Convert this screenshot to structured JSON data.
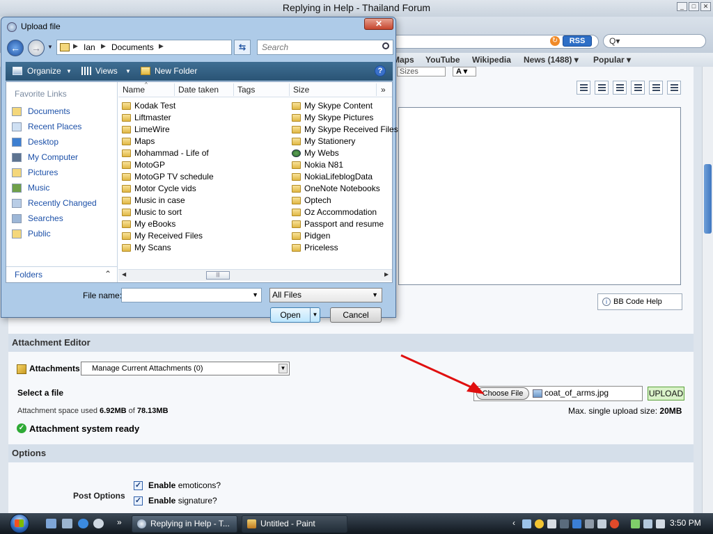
{
  "browser": {
    "window_title": "Replying in Help - Thailand Forum",
    "search_placeholder": "Q▾",
    "rss": "RSS",
    "bookmarks": [
      "Maps",
      "YouTube",
      "Wikipedia",
      "News (1488) ▾",
      "Popular ▾"
    ],
    "window_buttons": [
      "_",
      "□",
      "✕"
    ]
  },
  "editor": {
    "sizes_label": "Sizes",
    "color_label": "A ▾",
    "bbcode_help": "BB Code Help"
  },
  "attachment_editor": {
    "header": "Attachment Editor",
    "attachments_label": "Attachments",
    "attachments_select": "Manage Current Attachments (0)",
    "select_file_label": "Select a file",
    "space_used_prefix": "Attachment space used",
    "space_used": "6.92MB",
    "space_of": "of",
    "space_total": "78.13MB",
    "choose_file": "Choose File",
    "file_name": "coat_of_arms.jpg",
    "upload": "UPLOAD",
    "max_size_label": "Max. single upload size:",
    "max_size": "20MB",
    "ready": "Attachment system ready"
  },
  "options": {
    "header": "Options",
    "post_options_label": "Post Options",
    "checkboxes": [
      {
        "bold": "Enable",
        "rest": " emoticons?"
      },
      {
        "bold": "Enable",
        "rest": " signature?"
      }
    ]
  },
  "dialog": {
    "title": "Upload file",
    "close": "✕",
    "breadcrumb": [
      "Ian",
      "Documents"
    ],
    "search_placeholder": "Search",
    "toolbar": {
      "organize": "Organize",
      "views": "Views",
      "new_folder": "New Folder"
    },
    "favorites_title": "Favorite Links",
    "favorites": [
      "Documents",
      "Recent Places",
      "Desktop",
      "My Computer",
      "Pictures",
      "Music",
      "Recently Changed",
      "Searches",
      "Public"
    ],
    "folders_label": "Folders",
    "columns": [
      "Name",
      "Date taken",
      "Tags",
      "Size"
    ],
    "files_col1": [
      "Kodak Test",
      "Liftmaster",
      "LimeWire",
      "Maps",
      "Mohammad - Life of",
      "MotoGP",
      "MotoGP TV schedule",
      "Motor Cycle vids",
      "Music in case",
      "Music to sort",
      "My eBooks",
      "My Received Files",
      "My Scans"
    ],
    "files_col2": [
      "My Skype Content",
      "My Skype Pictures",
      "My Skype Received Files",
      "My Stationery",
      "My Webs",
      "Nokia N81",
      "NokiaLifeblogData",
      "OneNote Notebooks",
      "Optech",
      "Oz Accommodation",
      "Passport and resume",
      "Pidgen",
      "Priceless"
    ],
    "file_name_label": "File name:",
    "file_name_value": "",
    "file_type": "All Files",
    "open": "Open",
    "cancel": "Cancel"
  },
  "taskbar": {
    "tasks": [
      "Replying in Help - T...",
      "Untitled - Paint"
    ],
    "clock": "3:50 PM"
  }
}
